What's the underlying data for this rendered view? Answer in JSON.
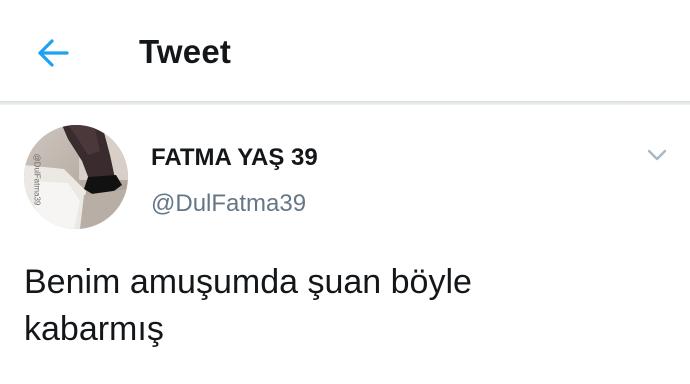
{
  "header": {
    "title": "Tweet",
    "back_icon": "arrow-left-icon"
  },
  "tweet": {
    "author": {
      "display_name": "FATMA YAŞ 39",
      "handle": "@DulFatma39",
      "avatar_watermark": "@DulFatma39"
    },
    "menu_icon": "chevron-down-icon",
    "text_lines": [
      "Benim amuşumda şuan böyle",
      "kabarmış"
    ]
  },
  "colors": {
    "accent": "#1da1f2",
    "text_primary": "#14171a",
    "text_secondary": "#657786",
    "divider": "#e1e8ed",
    "caret": "#aab8c2"
  }
}
